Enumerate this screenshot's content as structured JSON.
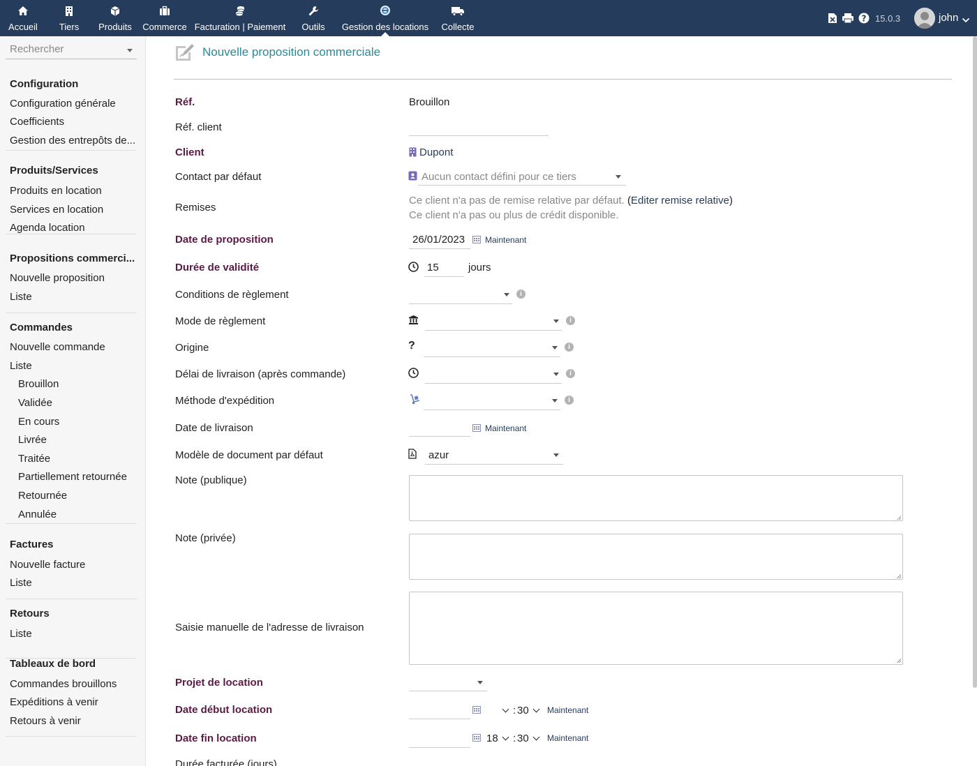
{
  "topbar": {
    "menu": [
      {
        "label": "Accueil",
        "icon": "home-icon"
      },
      {
        "label": "Tiers",
        "icon": "building-icon"
      },
      {
        "label": "Produits",
        "icon": "cube-icon"
      },
      {
        "label": "Commerce",
        "icon": "briefcase-icon"
      },
      {
        "label": "Facturation | Paiement",
        "icon": "coins-icon"
      },
      {
        "label": "Outils",
        "icon": "wrench-icon"
      },
      {
        "label": "Gestion des locations",
        "icon": "rental-logo-icon"
      },
      {
        "label": "Collecte",
        "icon": "truck-icon"
      }
    ],
    "active_menu": "Gestion des locations",
    "version": "15.0.3",
    "user": "john",
    "colors": {
      "bar": "#263c5c",
      "text": "#ffffff"
    }
  },
  "sidebar": {
    "search_placeholder": "Rechercher",
    "sections": [
      {
        "title": "Configuration",
        "items": [
          "Configuration générale",
          "Coefficients",
          "Gestion des entrepôts de..."
        ]
      },
      {
        "title": "Produits/Services",
        "items": [
          "Produits en location",
          "Services en location",
          "Agenda location"
        ]
      },
      {
        "title": "Propositions commerci...",
        "items": [
          "Nouvelle proposition",
          "Liste"
        ]
      },
      {
        "title": "Commandes",
        "items": [
          "Nouvelle commande",
          "Liste"
        ],
        "subitems": [
          "Brouillon",
          "Validée",
          "En cours",
          "Livrée",
          "Traitée",
          "Partiellement retournée",
          "Retournée",
          "Annulée"
        ]
      },
      {
        "title": "Factures",
        "items": [
          "Nouvelle facture",
          "Liste"
        ]
      },
      {
        "title": "Retours",
        "items": [
          "Liste"
        ]
      },
      {
        "title": "Tableaux de bord",
        "items": [
          "Commandes brouillons",
          "Expéditions à venir",
          "Retours à venir"
        ]
      }
    ]
  },
  "page": {
    "title": "Nouvelle proposition commerciale",
    "title_color": "#2a8a96",
    "required_label_color": "#5a1a45"
  },
  "form": {
    "ref": {
      "label": "Réf.",
      "value": "Brouillon"
    },
    "ref_client": {
      "label": "Réf. client",
      "value": ""
    },
    "client": {
      "label": "Client",
      "value": "Dupont"
    },
    "contact": {
      "label": "Contact par défaut",
      "placeholder": "Aucun contact défini pour ce tiers"
    },
    "remises": {
      "label": "Remises",
      "line1": "Ce client n'a pas de remise relative par défaut.",
      "link": "Editer remise relative",
      "line2": "Ce client n'a pas ou plus de crédit disponible."
    },
    "date_proposition": {
      "label": "Date de proposition",
      "value": "26/01/2023",
      "now": "Maintenant"
    },
    "duree_validite": {
      "label": "Durée de validité",
      "value": "15",
      "unit": "jours"
    },
    "conditions_reglement": {
      "label": "Conditions de règlement",
      "value": ""
    },
    "mode_reglement": {
      "label": "Mode de règlement",
      "value": ""
    },
    "origine": {
      "label": "Origine",
      "value": ""
    },
    "delai_livraison": {
      "label": "Délai de livraison (après commande)",
      "value": ""
    },
    "methode_expedition": {
      "label": "Méthode d'expédition",
      "value": ""
    },
    "date_livraison": {
      "label": "Date de livraison",
      "value": "",
      "now": "Maintenant"
    },
    "modele_document": {
      "label": "Modèle de document par défaut",
      "value": "azur"
    },
    "note_publique": {
      "label": "Note (publique)",
      "value": ""
    },
    "note_privee": {
      "label": "Note (privée)",
      "value": ""
    },
    "adresse_livraison": {
      "label": "Saisie manuelle de l'adresse de livraison",
      "value": ""
    },
    "projet_location": {
      "label": "Projet de location",
      "value": ""
    },
    "date_debut_location": {
      "label": "Date début location",
      "date": "",
      "hour": "",
      "minute": "30",
      "now": "Maintenant"
    },
    "date_fin_location": {
      "label": "Date fin location",
      "date": "",
      "hour": "18",
      "minute": "30",
      "now": "Maintenant"
    },
    "duree_facturee": {
      "label": "Durée facturée (jours)"
    }
  }
}
